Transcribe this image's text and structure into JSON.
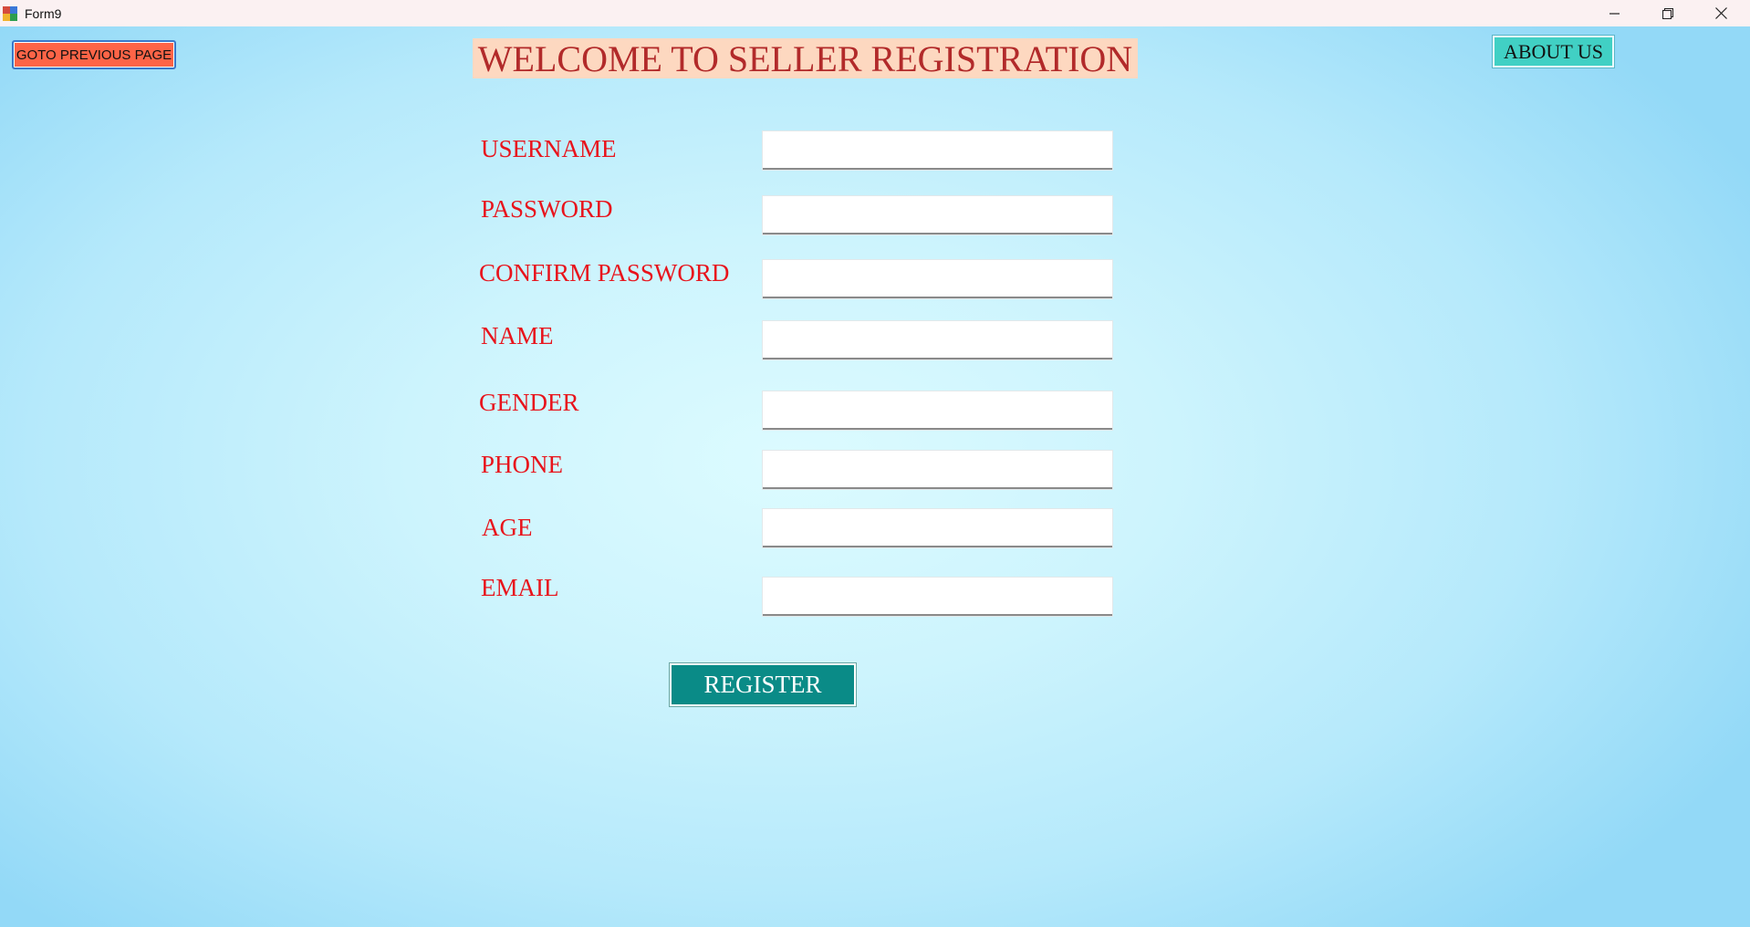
{
  "window": {
    "title": "Form9"
  },
  "header": {
    "back_button": "GOTO PREVIOUS PAGE",
    "title": "WELCOME TO SELLER REGISTRATION",
    "about_button": "ABOUT US"
  },
  "form": {
    "fields": [
      {
        "label": "USERNAME",
        "value": ""
      },
      {
        "label": "PASSWORD",
        "value": ""
      },
      {
        "label": "CONFIRM PASSWORD",
        "value": ""
      },
      {
        "label": "NAME",
        "value": ""
      },
      {
        "label": "GENDER",
        "value": ""
      },
      {
        "label": "PHONE",
        "value": ""
      },
      {
        "label": "AGE",
        "value": ""
      },
      {
        "label": "EMAIL",
        "value": ""
      }
    ],
    "submit_label": "REGISTER"
  },
  "icons": {
    "app": "app-icon",
    "minimize": "minimize-icon",
    "restore": "restore-icon",
    "close": "close-icon"
  },
  "colors": {
    "back_button_bg": "#fe6447",
    "title_bg": "#fdd8c0",
    "title_text": "#b22a2a",
    "about_button_bg": "#41d0c4",
    "label_text": "#e8141c",
    "register_bg": "#0a8b87"
  }
}
